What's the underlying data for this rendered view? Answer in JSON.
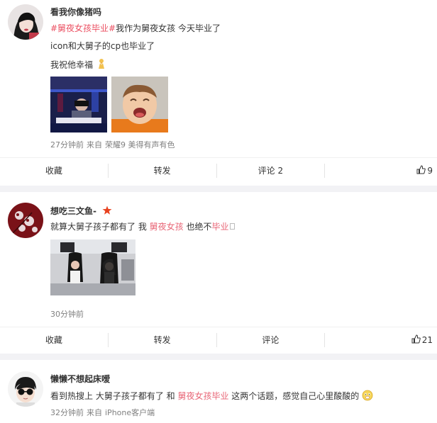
{
  "posts": [
    {
      "username": "看我你像猪吗",
      "lines": {
        "l1_tag": "#舅夜女孩毕业#",
        "l1_rest": "我作为舅夜女孩 今天毕业了",
        "l2": "icon和大舅子的cp也毕业了",
        "l3": "我祝他幸福"
      },
      "meta": {
        "time": "27分钟前",
        "from": "来自",
        "source": "荣耀9 美得有声有色"
      },
      "actions": {
        "favorite": "收藏",
        "repost": "转发",
        "comment": "评论 2",
        "likes": "9"
      }
    },
    {
      "username": "想吃三文鱼-",
      "lines": {
        "l1_a": "就算大舅子孩子都有了 我 ",
        "l1_hl1": "舅夜女孩",
        "l1_b": " 也绝不",
        "l1_hl2": "毕业"
      },
      "meta": {
        "time": "30分钟前"
      },
      "actions": {
        "favorite": "收藏",
        "repost": "转发",
        "comment": "评论",
        "likes": "21"
      }
    },
    {
      "username": "懒懒不想起床嗳",
      "lines": {
        "l1_a": "看到热搜上 大舅子孩子都有了 和 ",
        "l1_hl": "舅夜女孩毕业",
        "l1_b": " 这两个话题，感觉自己心里酸酸的"
      },
      "meta": {
        "time": "32分钟前",
        "from": "来自",
        "source": "iPhone客户端"
      }
    }
  ],
  "colors": {
    "highlight": "#eb4f61",
    "vip_star": "#e8421f",
    "meta": "#808080"
  },
  "icons": [
    "thumb-up-icon",
    "praying-emoji-icon",
    "vip-star-icon",
    "sour-face-emoji-icon"
  ]
}
